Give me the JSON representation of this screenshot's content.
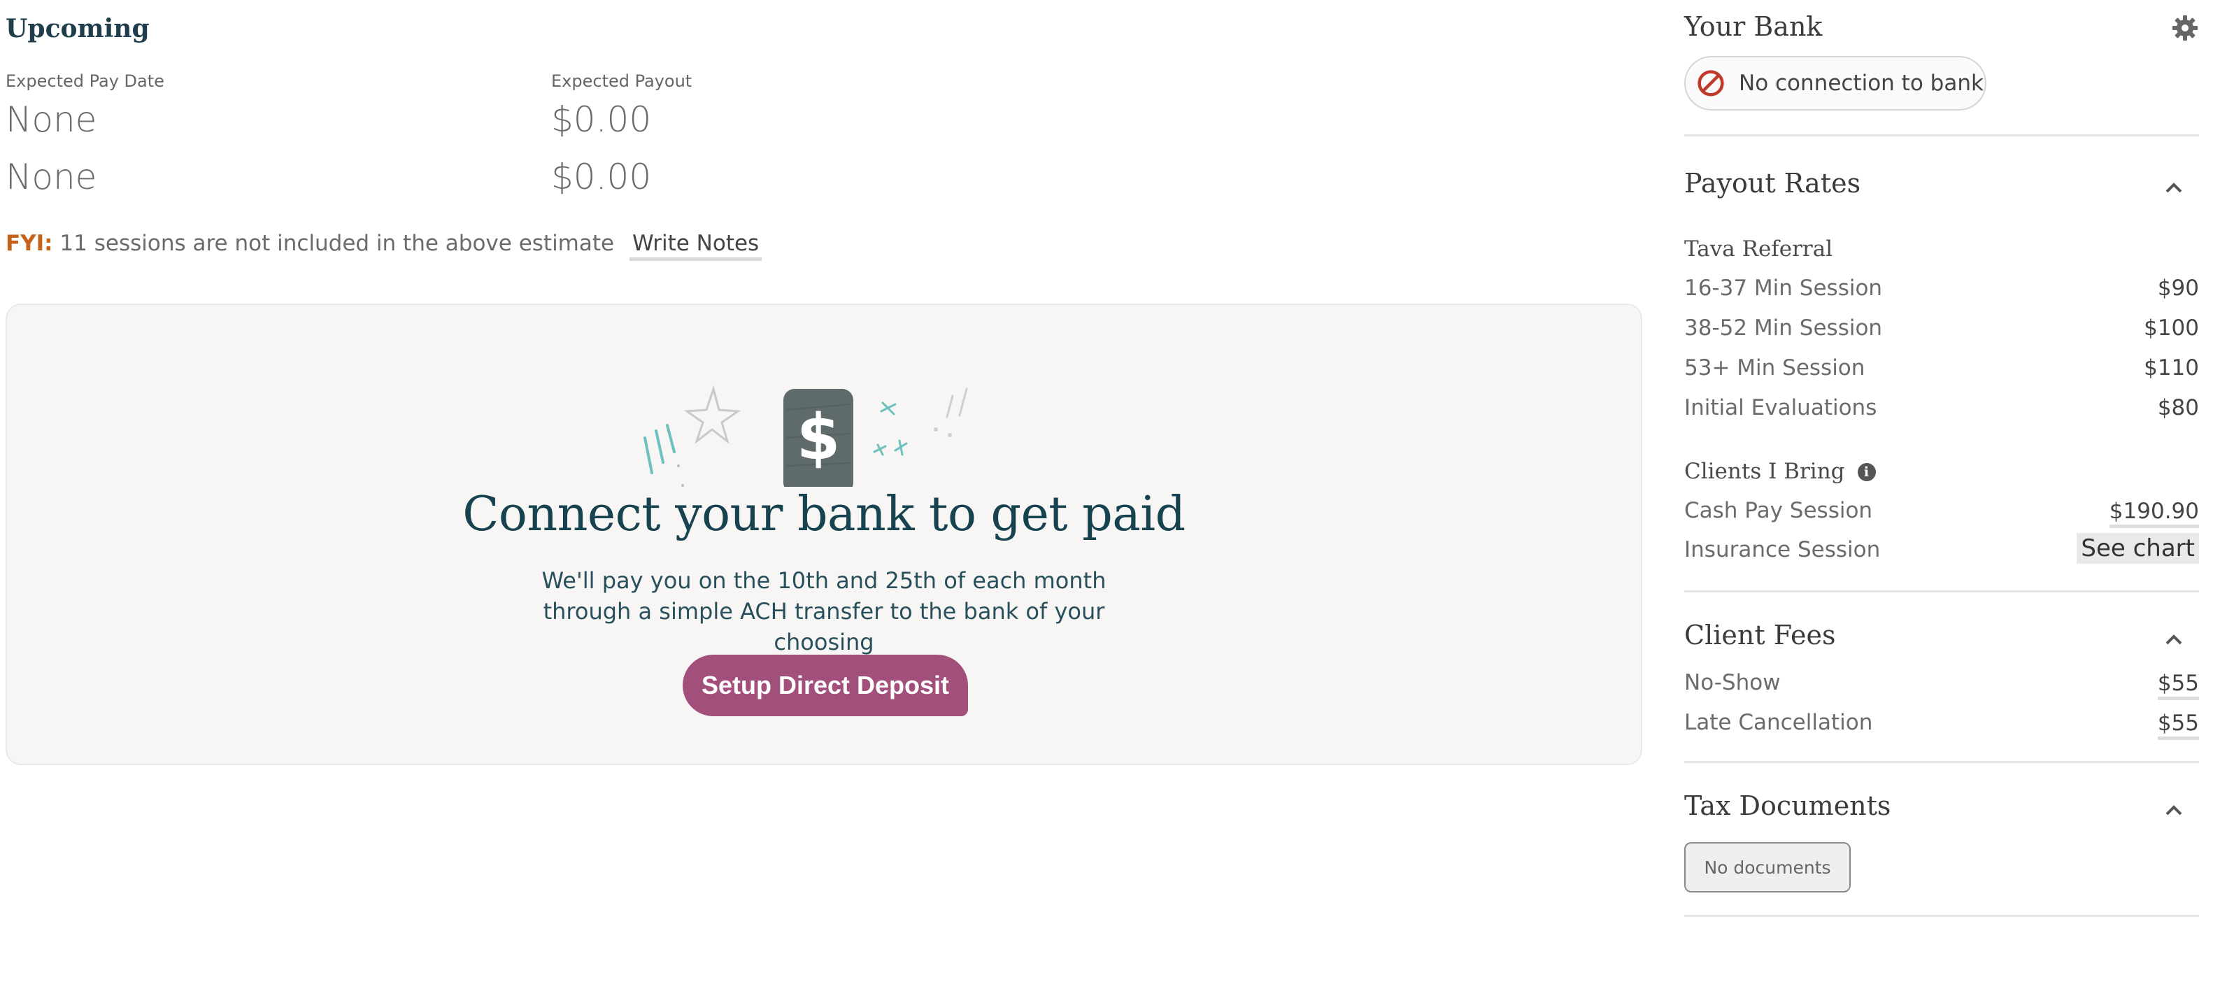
{
  "upcoming": {
    "title": "Upcoming",
    "pay_date_label": "Expected Pay Date",
    "payout_label": "Expected Payout",
    "rows": [
      {
        "date": "None",
        "payout": "$0.00"
      },
      {
        "date": "None",
        "payout": "$0.00"
      }
    ],
    "fyi_label": "FYI:",
    "fyi_text": "11 sessions are not included in the above estimate",
    "write_notes": "Write Notes"
  },
  "connect_card": {
    "title": "Connect your bank to get paid",
    "subtitle": "We'll pay you on the 10th and 25th of each month through a simple ACH transfer to the bank of your choosing",
    "button": "Setup Direct Deposit",
    "icon": "dollar-icon"
  },
  "bank": {
    "title": "Your Bank",
    "status": "No connection to bank",
    "status_color": "#c0392b"
  },
  "payout_rates": {
    "title": "Payout Rates",
    "tava_title": "Tava Referral",
    "tava_rows": [
      {
        "label": "16-37 Min Session",
        "value": "$90"
      },
      {
        "label": "38-52 Min Session",
        "value": "$100"
      },
      {
        "label": "53+ Min Session",
        "value": "$110"
      },
      {
        "label": "Initial Evaluations",
        "value": "$80"
      }
    ],
    "clients_title": "Clients I Bring",
    "clients_rows": [
      {
        "label": "Cash Pay Session",
        "value": "$190.90"
      },
      {
        "label": "Insurance Session",
        "value": "See chart"
      }
    ]
  },
  "client_fees": {
    "title": "Client Fees",
    "rows": [
      {
        "label": "No-Show",
        "value": "$55"
      },
      {
        "label": "Late Cancellation",
        "value": "$55"
      }
    ]
  },
  "tax_documents": {
    "title": "Tax Documents",
    "empty": "No documents"
  },
  "colors": {
    "accent_button": "#a24f7c",
    "heading": "#16434f",
    "fyi": "#c4621b"
  }
}
